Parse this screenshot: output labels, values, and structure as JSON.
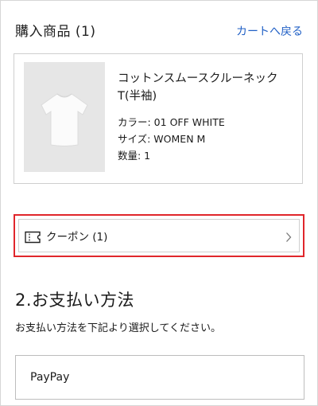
{
  "header": {
    "title": "購入商品 (1)",
    "back_link": "カートへ戻る"
  },
  "product": {
    "name": "コットンスムースクルーネックT(半袖)",
    "color": "カラー: 01 OFF WHITE",
    "size": "サイズ: WOMEN M",
    "quantity": "数量: 1",
    "image_icon": "white-tshirt-icon"
  },
  "coupon": {
    "label": "クーポン (1)",
    "icon": "ticket-icon",
    "chevron": "chevron-right-icon",
    "highlight_color": "#e0262b"
  },
  "payment": {
    "section_title": "2.お支払い方法",
    "description": "お支払い方法を下記より選択してください。",
    "options": [
      {
        "label": "PayPay"
      }
    ]
  },
  "colors": {
    "link": "#2261c6",
    "text": "#1b1b1b",
    "border": "#cfcfcf"
  }
}
